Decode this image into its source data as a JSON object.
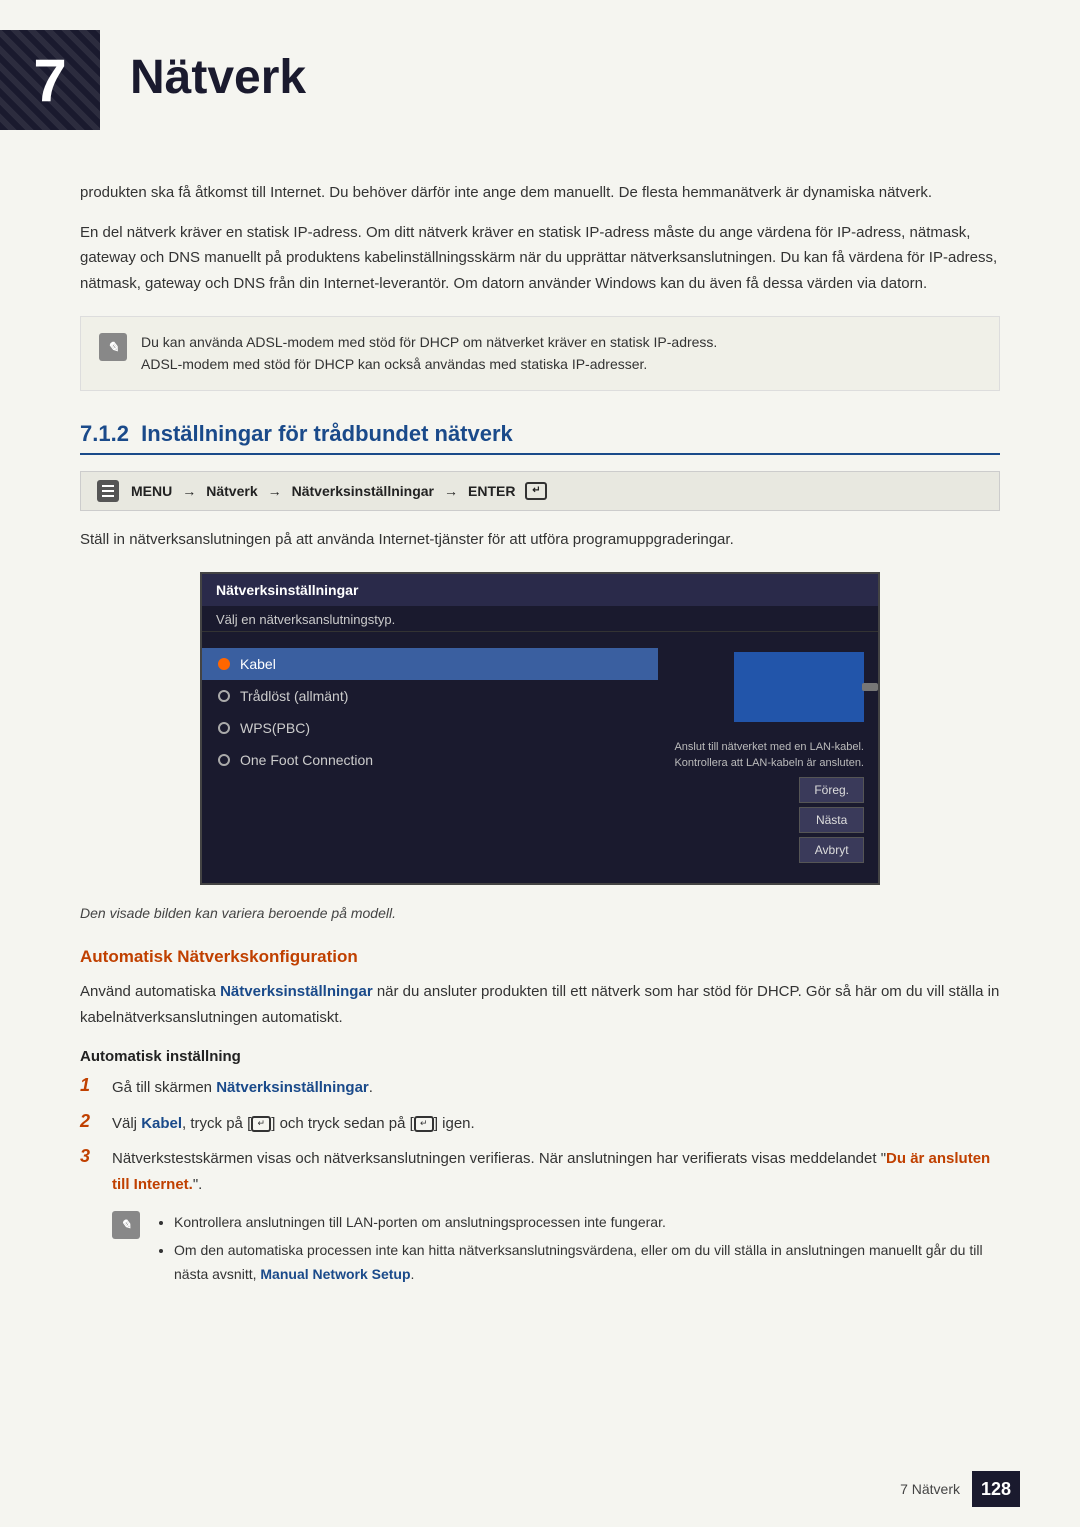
{
  "chapter": {
    "number": "7",
    "title": "Nätverk"
  },
  "intro_paragraphs": [
    "produkten ska få åtkomst till Internet. Du behöver därför inte ange dem manuellt. De flesta hemmanätverk är dynamiska nätverk.",
    "En del nätverk kräver en statisk IP-adress. Om ditt nätverk kräver en statisk IP-adress måste du ange värdena för IP-adress, nätmask, gateway och DNS manuellt på produktens kabelinställningsskärm när du upprättar nätverksanslutningen. Du kan få värdena för IP-adress, nätmask, gateway och DNS från din Internet-leverantör. Om datorn använder Windows kan du även få dessa värden via datorn."
  ],
  "note_box": {
    "text1": "Du kan använda ADSL-modem med stöd för DHCP om nätverket kräver en statisk IP-adress.",
    "text2": "ADSL-modem med stöd för DHCP kan också användas med statiska IP-adresser."
  },
  "section": {
    "number": "7.1.2",
    "title": "Inställningar för trådbundet nätverk"
  },
  "menu_path": {
    "menu": "MENU",
    "arrow": "→",
    "item1": "Nätverk",
    "item2": "Nätverksinställningar",
    "enter": "ENTER"
  },
  "intro_line": "Ställ in nätverksanslutningen på att använda Internet-tjänster för att utföra programuppgraderingar.",
  "ui": {
    "title": "Nätverksinställningar",
    "subtitle": "Välj en nätverksanslutningstyp.",
    "options": [
      {
        "label": "Kabel",
        "selected": true
      },
      {
        "label": "Trådlöst (allmänt)",
        "selected": false
      },
      {
        "label": "WPS(PBC)",
        "selected": false
      },
      {
        "label": "One Foot Connection",
        "selected": false
      }
    ],
    "description_line1": "Anslut till nätverket med en LAN-kabel.",
    "description_line2": "Kontrollera att LAN-kabeln är ansluten.",
    "buttons": [
      "Föreg.",
      "Nästa",
      "Avbryt"
    ]
  },
  "caption": "Den visade bilden kan variera beroende på modell.",
  "auto_config": {
    "heading": "Automatisk Nätverkskonfiguration",
    "text1_part1": "Använd automatiska ",
    "text1_bold": "Nätverksinställningar",
    "text1_part2": " när du ansluter produkten till ett nätverk som har stöd för DHCP. Gör så här om du vill ställa in kabelnätverksanslutningen automatiskt.",
    "steps_heading": "Automatisk inställning",
    "steps": [
      {
        "num": "1",
        "text_part1": "Gå till skärmen ",
        "text_bold": "Nätverksinställningar",
        "text_part2": "."
      },
      {
        "num": "2",
        "text_part1": "Välj ",
        "text_bold1": "Kabel",
        "text_part2": ", tryck på [",
        "enter1": "↵",
        "text_part3": "] och tryck sedan på [",
        "enter2": "↵",
        "text_part4": "] igen."
      },
      {
        "num": "3",
        "text_part1": "Nätverkstestskärmen visas och nätverksanslutningen verifieras. När anslutningen har verifierats visas meddelandet \"",
        "text_bold": "Du är ansluten till Internet.",
        "text_part2": "\"."
      }
    ],
    "note_bullets": [
      "Kontrollera anslutningen till LAN-porten om anslutningsprocessen inte fungerar.",
      "Om den automatiska processen inte kan hitta nätverksanslutningsvärdena, eller om du vill ställa in anslutningen manuellt går du till nästa avsnitt, Manual Network Setup."
    ],
    "manual_setup_bold": "Manual Network Setup"
  },
  "footer": {
    "chapter_label": "7 Nätverk",
    "page_number": "128"
  }
}
